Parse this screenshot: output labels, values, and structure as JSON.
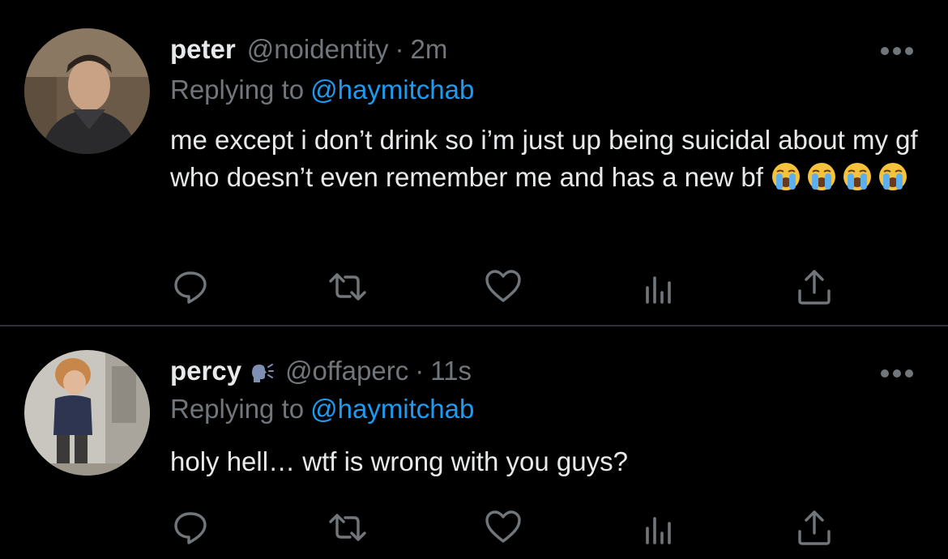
{
  "tweets": [
    {
      "name": "peter",
      "handle": "@noidentity",
      "separator": "·",
      "time": "2m",
      "replying_label": "Replying to",
      "replying_to": "@haymitchab",
      "text": "me except i don’t drink so i’m just up being suicidal about my gf who doesn’t even remember me and has a new bf",
      "emojis": [
        "loudly-crying-face",
        "loudly-crying-face",
        "loudly-crying-face",
        "loudly-crying-face"
      ],
      "avatar_icon": "profile-photo"
    },
    {
      "name": "percy",
      "name_icon": "speaking-head-icon",
      "handle": "@offaperc",
      "separator": "·",
      "time": "11s",
      "replying_label": "Replying to",
      "replying_to": "@haymitchab",
      "text": "holy hell… wtf is wrong with you guys?",
      "avatar_icon": "profile-photo"
    }
  ],
  "actions": [
    "reply-icon",
    "retweet-icon",
    "like-icon",
    "analytics-icon",
    "share-icon"
  ],
  "colors": {
    "background": "#000000",
    "text": "#e7e9ea",
    "secondary": "#71767b",
    "link": "#1d9bf0",
    "divider": "#2f3336"
  }
}
